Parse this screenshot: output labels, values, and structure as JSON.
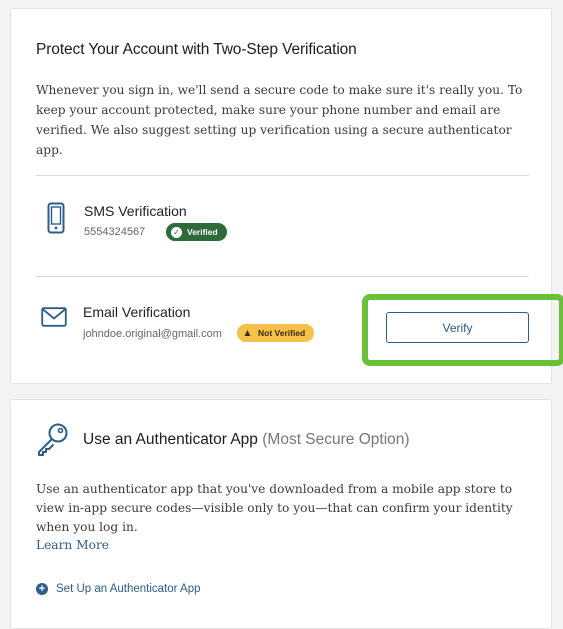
{
  "two_step": {
    "title": "Protect Your Account with Two-Step Verification",
    "description": "Whenever you sign in, we'll send a secure code to make sure it's really you. To keep your account protected, make sure your phone number and email are verified. We also suggest setting up verification using a secure authenticator app.",
    "sms": {
      "label": "SMS Verification",
      "value": "5554324567",
      "badge": "Verified",
      "icon": "phone-icon"
    },
    "email": {
      "label": "Email Verification",
      "value": "johndoe.original@gmail.com",
      "badge": "Not Verified",
      "icon": "mail-icon",
      "button_label": "Verify"
    }
  },
  "authenticator": {
    "title_main": "Use an Authenticator App",
    "title_note": "(Most Secure Option)",
    "description": "Use an authenticator app that you've downloaded from a mobile app store to view in-app secure codes—visible only to you—that can confirm your identity when you log in.",
    "learn_more": "Learn More",
    "setup_link": "Set Up an Authenticator App",
    "icon": "key-icon"
  },
  "colors": {
    "verified_badge": "#2e6b3a",
    "not_verified_badge": "#f6c14a",
    "highlight": "#6bbf3a",
    "link": "#2d5d8a"
  }
}
